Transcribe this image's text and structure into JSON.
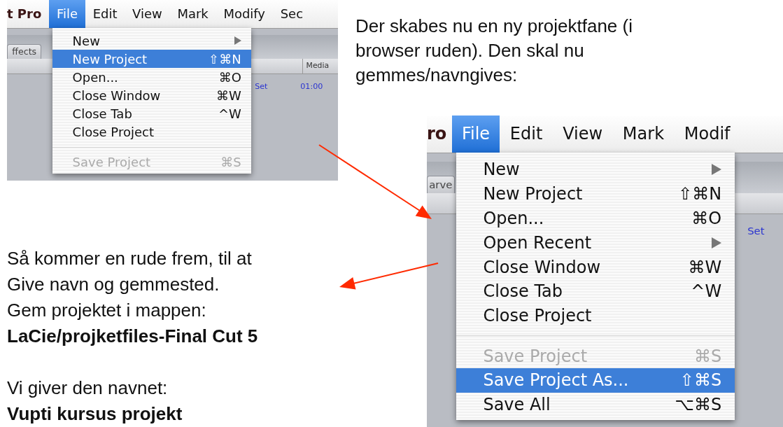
{
  "screenshots": [
    {
      "menubar": [
        {
          "label": "t Pro",
          "kind": "app"
        },
        {
          "label": "File",
          "kind": "menu",
          "selected": true
        },
        {
          "label": "Edit",
          "kind": "menu",
          "selected": false
        },
        {
          "label": "View",
          "kind": "menu",
          "selected": false
        },
        {
          "label": "Mark",
          "kind": "menu",
          "selected": false
        },
        {
          "label": "Modify",
          "kind": "menu",
          "selected": false
        },
        {
          "label": "Sec",
          "kind": "menu",
          "selected": false
        }
      ],
      "panel_tab": "ffects",
      "column_header": "Media",
      "cells": [
        "Set",
        "01:00"
      ],
      "menu": [
        {
          "kind": "item",
          "label": "New",
          "submenu": true,
          "selected": false,
          "disabled": false
        },
        {
          "kind": "item",
          "label": "New Project",
          "shortcut": "⇧⌘N",
          "submenu": false,
          "selected": true,
          "disabled": false
        },
        {
          "kind": "item",
          "label": "Open...",
          "shortcut": "⌘O",
          "submenu": false,
          "selected": false,
          "disabled": false
        },
        {
          "kind": "item",
          "label": "Close Window",
          "shortcut": "⌘W",
          "submenu": false,
          "selected": false,
          "disabled": false
        },
        {
          "kind": "item",
          "label": "Close Tab",
          "shortcut": "^W",
          "submenu": false,
          "selected": false,
          "disabled": false
        },
        {
          "kind": "item",
          "label": "Close Project",
          "submenu": false,
          "selected": false,
          "disabled": false
        },
        {
          "kind": "separator"
        },
        {
          "kind": "item",
          "label": "Save Project",
          "shortcut": "⌘S",
          "submenu": false,
          "selected": false,
          "disabled": true
        }
      ]
    },
    {
      "menubar": [
        {
          "label": "ro",
          "kind": "app"
        },
        {
          "label": "File",
          "kind": "menu",
          "selected": true
        },
        {
          "label": "Edit",
          "kind": "menu",
          "selected": false
        },
        {
          "label": "View",
          "kind": "menu",
          "selected": false
        },
        {
          "label": "Mark",
          "kind": "menu",
          "selected": false
        },
        {
          "label": "Modif",
          "kind": "menu",
          "selected": false
        }
      ],
      "panel_tab": "arve",
      "cells": [
        "Set"
      ],
      "menu": [
        {
          "kind": "item",
          "label": "New",
          "submenu": true,
          "selected": false,
          "disabled": false
        },
        {
          "kind": "item",
          "label": "New Project",
          "shortcut": "⇧⌘N",
          "submenu": false,
          "selected": false,
          "disabled": false
        },
        {
          "kind": "item",
          "label": "Open...",
          "shortcut": "⌘O",
          "submenu": false,
          "selected": false,
          "disabled": false
        },
        {
          "kind": "item",
          "label": "Open Recent",
          "submenu": true,
          "selected": false,
          "disabled": false
        },
        {
          "kind": "item",
          "label": "Close Window",
          "shortcut": "⌘W",
          "submenu": false,
          "selected": false,
          "disabled": false
        },
        {
          "kind": "item",
          "label": "Close Tab",
          "shortcut": "^W",
          "submenu": false,
          "selected": false,
          "disabled": false
        },
        {
          "kind": "item",
          "label": "Close Project",
          "submenu": false,
          "selected": false,
          "disabled": false
        },
        {
          "kind": "separator"
        },
        {
          "kind": "item",
          "label": "Save Project",
          "shortcut": "⌘S",
          "submenu": false,
          "selected": false,
          "disabled": true
        },
        {
          "kind": "item",
          "label": "Save Project As...",
          "shortcut": "⇧⌘S",
          "submenu": false,
          "selected": true,
          "disabled": false
        },
        {
          "kind": "item",
          "label": "Save All",
          "shortcut": "⌥⌘S",
          "submenu": false,
          "selected": false,
          "disabled": false
        }
      ]
    }
  ],
  "intro": "Der skabes nu en ny projektfane (i browser ruden). Den skal nu gemmes/navngives:",
  "instructions": [
    {
      "lines": [
        {
          "text": "Så kommer en rude frem, til at",
          "bold": false
        },
        {
          "text": "Give navn og gemmested.",
          "bold": false
        },
        {
          "text": "Gem projektet i mappen:",
          "bold": false
        },
        {
          "text": "LaCie/projketfiles-Final Cut 5",
          "bold": true
        }
      ]
    },
    {
      "lines": [
        {
          "text": "Vi giver den navnet:",
          "bold": false
        },
        {
          "text": "Vupti kursus projekt",
          "bold": true
        }
      ]
    }
  ]
}
